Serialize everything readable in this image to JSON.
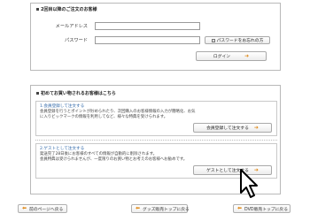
{
  "login": {
    "title": "2回目以降のご注文のお客様",
    "email_label": "メールアドレス",
    "password_label": "パスワード",
    "email_value": "",
    "password_value": "",
    "forgot_password_label": "パスワードをお忘れの方",
    "login_button_label": "ログイン"
  },
  "first_time": {
    "title": "初めてお買い物されるお客様はこちら",
    "option1": {
      "heading": "1.会員登録して注文する",
      "line1": "会員登録を行うとポイントが貯められたり、次回購入のお客様情報の入力が簡略化、お気",
      "line2": "に入りビックマークの情報を利用してなど、様々な特典を受けられます。",
      "button_label": "会員登録して注文する"
    },
    "option2": {
      "heading": "2.ゲストとして注文する",
      "line1": "発送完了28日後にお客様のすべての情報が自動的に削除されます。",
      "line2": "会員特典は受けられませんが、一度限りのお買い物とお考えのお客様へお勧めです。",
      "button_label": "ゲストとして注文する"
    }
  },
  "footer": {
    "back_label": "前のページへ戻る",
    "goods_top_label": "グッズ販売トップに戻る",
    "dvd_top_label": "DVD販売トップに戻る"
  }
}
